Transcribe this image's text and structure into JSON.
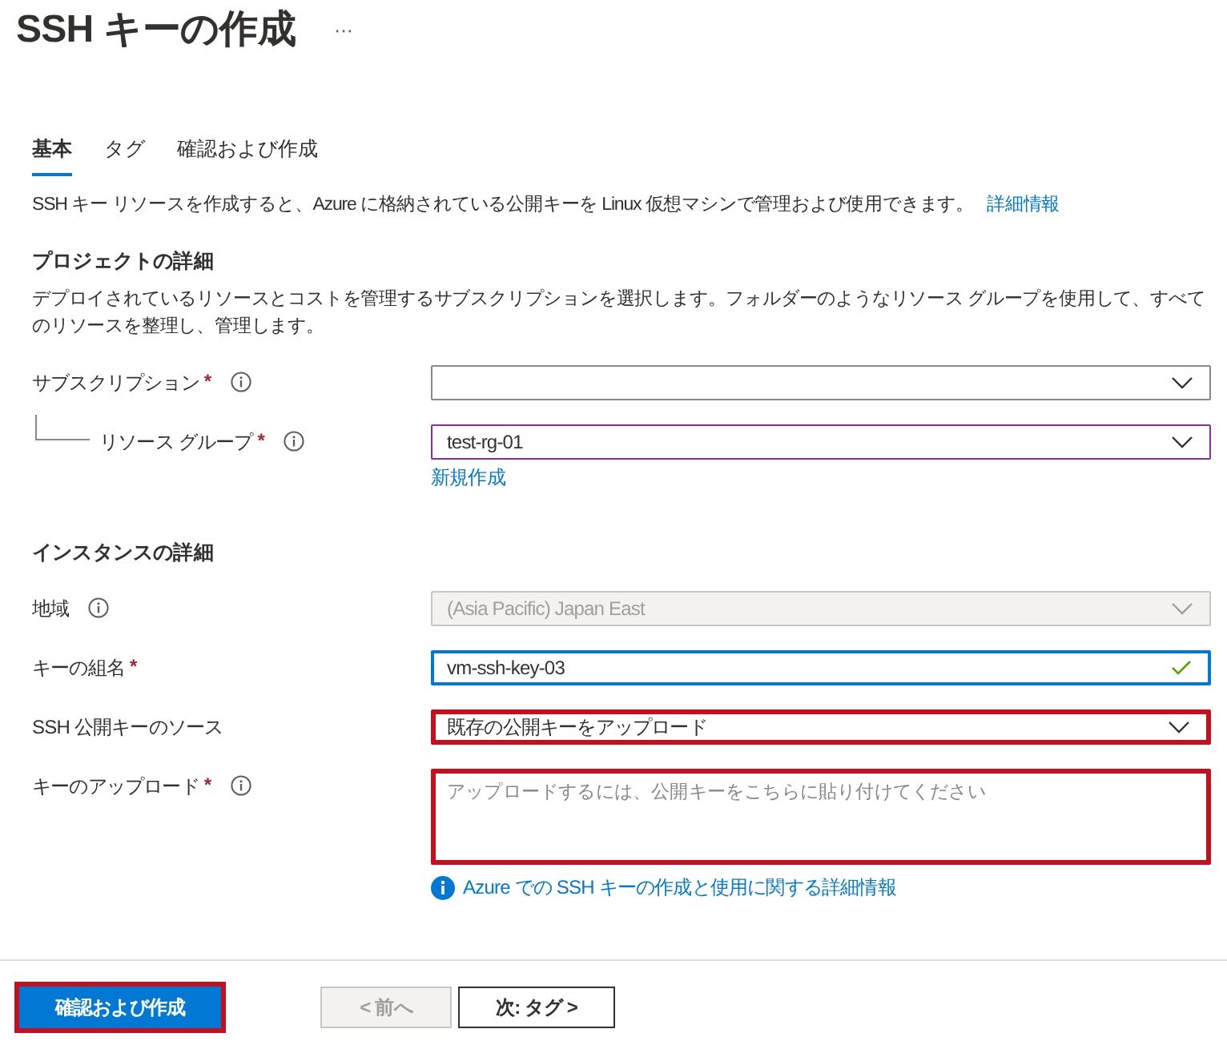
{
  "header": {
    "title": "SSH キーの作成",
    "more": "···"
  },
  "tabs": [
    {
      "label": "基本",
      "selected": true
    },
    {
      "label": "タグ",
      "selected": false
    },
    {
      "label": "確認および作成",
      "selected": false
    }
  ],
  "intro": {
    "text": "SSH キー リソースを作成すると、Azure に格納されている公開キーを Linux 仮想マシンで管理および使用できます。",
    "link": "詳細情報"
  },
  "sections": [
    {
      "heading": "プロジェクトの詳細",
      "description": "デプロイされているリソースとコストを管理するサブスクリプションを選択します。フォルダーのようなリソース グループを使用して、すべてのリソースを整理し、管理します。",
      "fields": [
        {
          "kind": "select",
          "label": "サブスクリプション",
          "required_mark": "*",
          "info": true,
          "disabled": false,
          "focused": false,
          "highlighted": false,
          "children": [
            {
              "kind": "select",
              "label": "リソース グループ",
              "required_mark": "*",
              "info": true,
              "value": "test-rg-01",
              "disabled": false,
              "focused": true,
              "highlighted": false,
              "link": "新規作成"
            }
          ]
        }
      ]
    },
    {
      "heading": "インスタンスの詳細",
      "fields": [
        {
          "kind": "select",
          "label": "地域",
          "info": true,
          "value": "(Asia Pacific) Japan East",
          "disabled": true,
          "focused": false,
          "highlighted": false
        },
        {
          "kind": "text",
          "label": "キーの組名",
          "required_mark": "*",
          "value": "vm-ssh-key-03",
          "disabled": false,
          "focused": true,
          "valid": true,
          "highlighted": false
        },
        {
          "kind": "select",
          "label": "SSH 公開キーのソース",
          "value": "既存の公開キーをアップロード",
          "disabled": false,
          "focused": false,
          "highlighted": true
        },
        {
          "kind": "textarea",
          "label": "キーのアップロード",
          "required_mark": "*",
          "info": true,
          "placeholder": "アップロードするには、公開キーをこちらに貼り付けてください",
          "disabled": false,
          "focused": false,
          "highlighted": true,
          "info_link": "Azure での SSH キーの作成と使用に関する詳細情報"
        }
      ]
    }
  ],
  "footer": {
    "buttons": [
      {
        "kind": "primary",
        "label": "確認および作成",
        "disabled": false,
        "highlighted": true
      },
      {
        "kind": "secondary",
        "label": "< 前へ",
        "disabled": true,
        "highlighted": false
      },
      {
        "kind": "secondary",
        "label": "次: タグ >",
        "disabled": false,
        "highlighted": false
      }
    ]
  }
}
